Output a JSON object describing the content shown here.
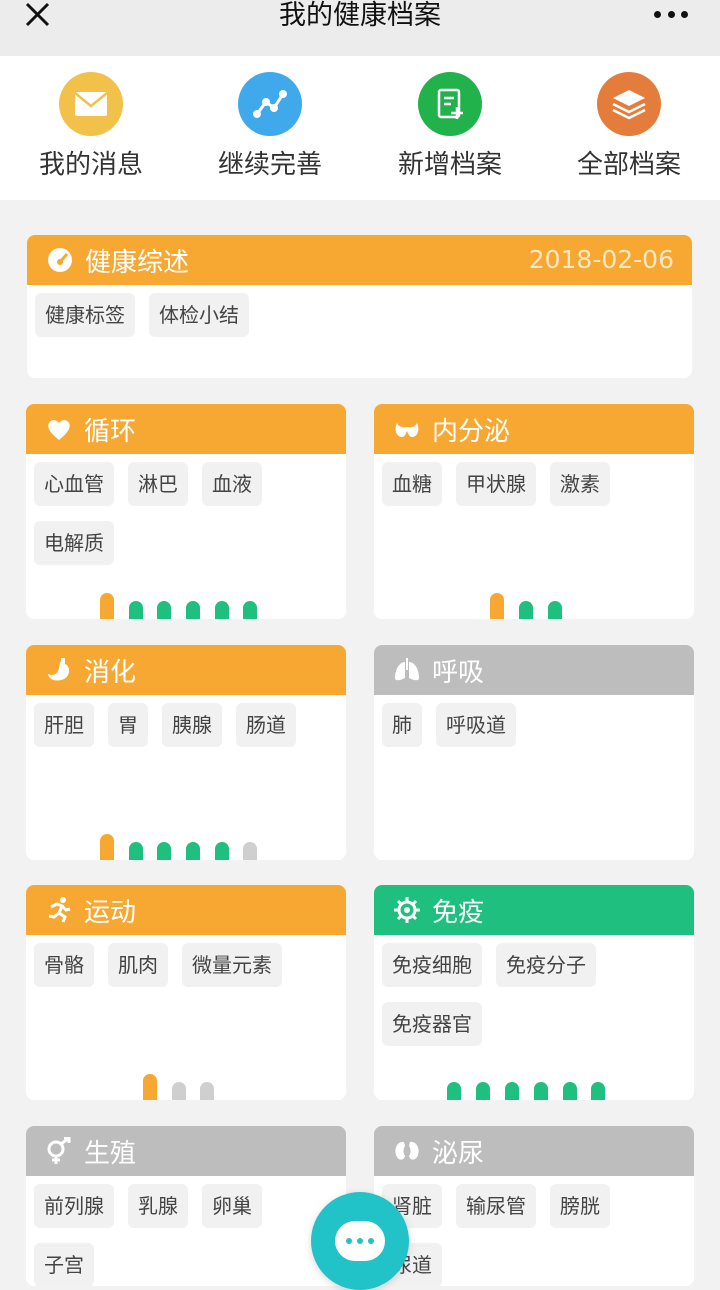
{
  "nav": {
    "title": "我的健康档案"
  },
  "quick": [
    {
      "label": "我的消息",
      "icon": "envelope-icon",
      "color": "#f1c14a"
    },
    {
      "label": "继续完善",
      "icon": "chart-line-icon",
      "color": "#3fa9ec"
    },
    {
      "label": "新增档案",
      "icon": "add-document-icon",
      "color": "#22b24c"
    },
    {
      "label": "全部档案",
      "icon": "layers-icon",
      "color": "#e47d3b"
    }
  ],
  "summary": {
    "title": "健康综述",
    "date": "2018-02-06",
    "tags": [
      "健康标签",
      "体检小结"
    ]
  },
  "cards": {
    "circulation": {
      "title": "循环",
      "tags": [
        "心血管",
        "淋巴",
        "血液",
        "电解质"
      ]
    },
    "endocrine": {
      "title": "内分泌",
      "tags": [
        "血糖",
        "甲状腺",
        "激素"
      ]
    },
    "digestion": {
      "title": "消化",
      "tags": [
        "肝胆",
        "胃",
        "胰腺",
        "肠道"
      ]
    },
    "respiration": {
      "title": "呼吸",
      "tags": [
        "肺",
        "呼吸道"
      ]
    },
    "exercise": {
      "title": "运动",
      "tags": [
        "骨骼",
        "肌肉",
        "微量元素"
      ]
    },
    "immunity": {
      "title": "免疫",
      "tags": [
        "免疫细胞",
        "免疫分子",
        "免疫器官"
      ]
    },
    "reproduction": {
      "title": "生殖",
      "tags": [
        "前列腺",
        "乳腺",
        "卵巢",
        "子宫"
      ]
    },
    "urinary": {
      "title": "泌尿",
      "tags": [
        "肾脏",
        "输尿管",
        "膀胱",
        "尿道"
      ]
    }
  },
  "colors": {
    "orange": "#f6a833",
    "gray": "#bdbdbd",
    "green": "#1fbf7f",
    "fab": "#21c2c8"
  }
}
